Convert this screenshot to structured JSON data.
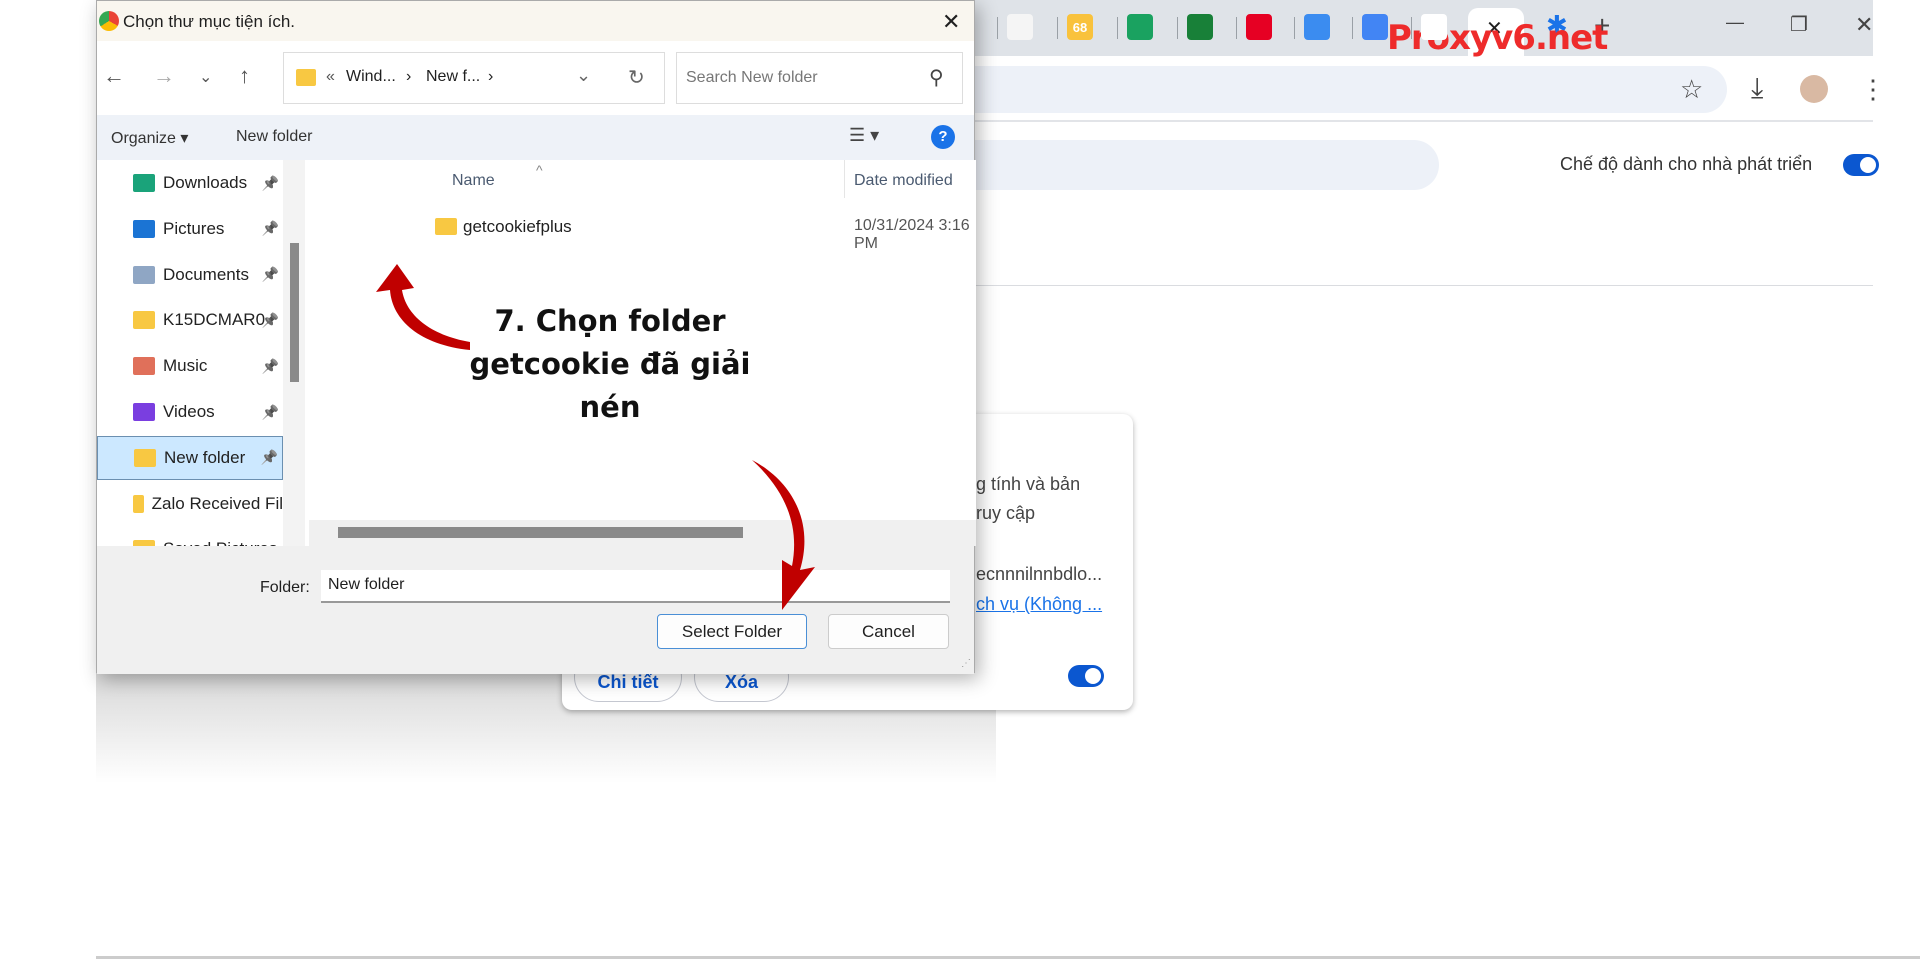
{
  "browser": {
    "tabs": [
      {
        "icon": "news-icon",
        "color": "#f5f5f5"
      },
      {
        "icon": "68-icon",
        "label": "68",
        "color": "#f9c23c"
      },
      {
        "icon": "plus-circle-icon",
        "color": "#1aa260"
      },
      {
        "icon": "sheets-icon",
        "color": "#188038"
      },
      {
        "icon": "pinterest-icon",
        "color": "#e60023"
      },
      {
        "icon": "runner-icon",
        "color": "#3b8cf0"
      },
      {
        "icon": "docs-icon",
        "color": "#4285f4"
      },
      {
        "icon": "google-icon",
        "color": "#ffffff"
      }
    ],
    "active_tab_close": "✕",
    "new_tab": "+",
    "window": {
      "minimize": "—",
      "restore": "❐",
      "close": "✕"
    },
    "toolbar": {
      "star": "☆",
      "download": "⤓",
      "menu": "⋮"
    },
    "developer_mode_label": "Chế độ dành cho nhà phát triển",
    "developer_mode_on": true,
    "extension_card": {
      "desc_line1": "g tính và bản",
      "desc_line2": "ruy cập",
      "id_text": "ecnnnilnnbdlo...",
      "link_text": "ch vụ (Không ...",
      "details_button": "Chi tiết",
      "remove_button": "Xóa",
      "enabled": true
    }
  },
  "dialog": {
    "title": "Chọn thư mục tiện ích.",
    "close": "✕",
    "breadcrumb": {
      "prefix": "«",
      "part1": "Wind...",
      "sep": "›",
      "part2": "New f...",
      "sep2": "›"
    },
    "search_placeholder": "Search New folder",
    "organize": "Organize ▾",
    "new_folder": "New folder",
    "view": "☰ ▾",
    "help": "?",
    "nav_items": [
      {
        "label": "Downloads",
        "icon": "download-icon",
        "color": "#1aa37a"
      },
      {
        "label": "Pictures",
        "icon": "pictures-icon",
        "color": "#1b74d4"
      },
      {
        "label": "Documents",
        "icon": "documents-icon",
        "color": "#8fa6c4"
      },
      {
        "label": "K15DCMAR0",
        "icon": "folder-icon",
        "color": "#f8c842"
      },
      {
        "label": "Music",
        "icon": "music-icon",
        "color": "#e0705a"
      },
      {
        "label": "Videos",
        "icon": "videos-icon",
        "color": "#7a3ee0"
      },
      {
        "label": "New folder",
        "icon": "folder-icon",
        "color": "#f8c842",
        "selected": true
      },
      {
        "label": "Zalo Received Fil",
        "icon": "folder-icon",
        "color": "#f8c842"
      },
      {
        "label": "Saved Pictures",
        "icon": "folder-icon",
        "color": "#f8c842"
      }
    ],
    "columns": {
      "name": "Name",
      "date": "Date modified"
    },
    "files": [
      {
        "name": "getcookiefplus",
        "date": "10/31/2024 3:16 PM"
      }
    ],
    "folder_label": "Folder:",
    "folder_value": "New folder",
    "select_button": "Select Folder",
    "cancel_button": "Cancel"
  },
  "annotation": {
    "line1": "7. Chọn folder",
    "line2": "getcookie đã giải nén",
    "arrow_color": "#c00000"
  },
  "watermark": "Proxyv6.net"
}
